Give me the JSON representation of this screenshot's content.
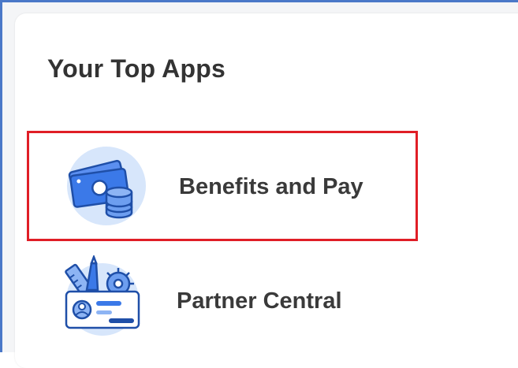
{
  "section": {
    "title": "Your Top Apps"
  },
  "apps": [
    {
      "label": "Benefits and Pay",
      "icon": "money-coins-icon",
      "selected": true
    },
    {
      "label": "Partner Central",
      "icon": "id-card-tools-icon",
      "selected": false
    }
  ],
  "colors": {
    "highlight_border": "#e01e26",
    "icon_blue": "#3b79e8",
    "icon_bg": "#d7e6fb",
    "frame_border": "#4a78c8"
  }
}
